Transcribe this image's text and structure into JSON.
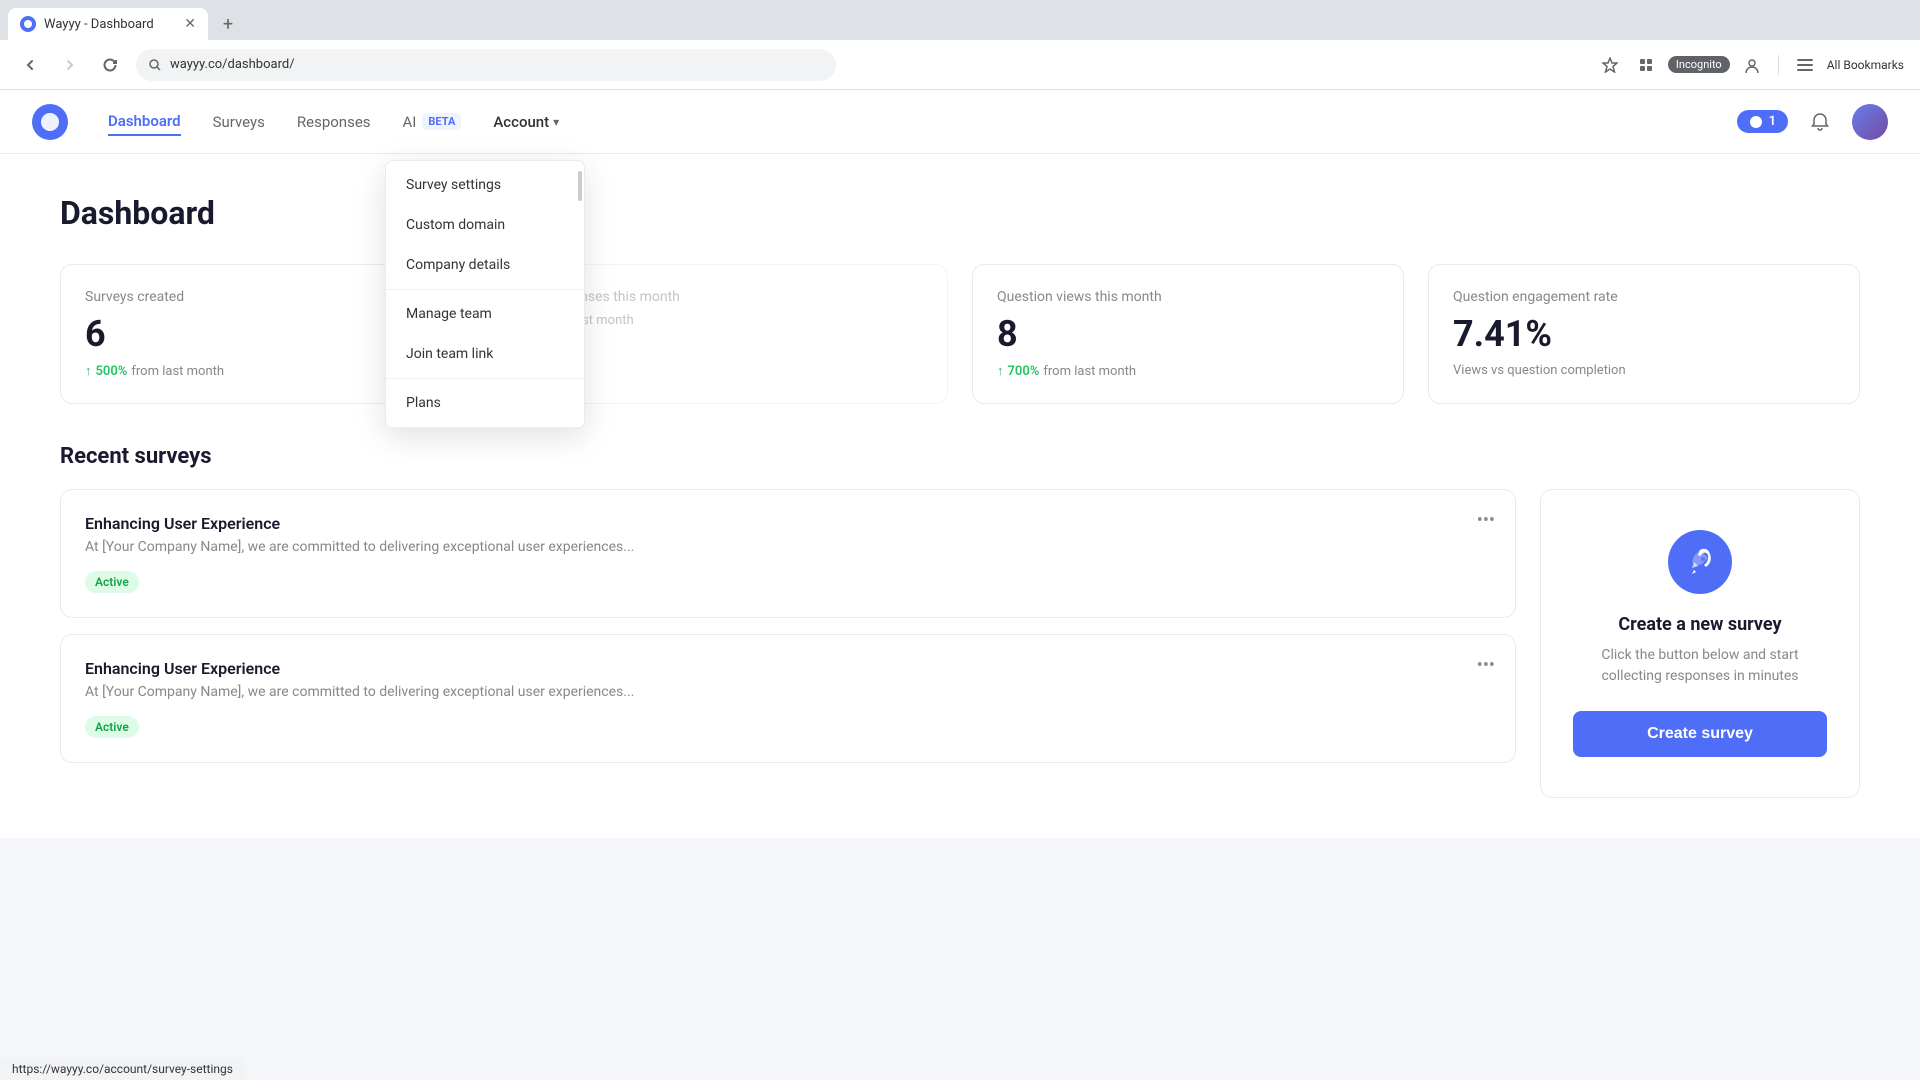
{
  "browser": {
    "tab_title": "Wayyy - Dashboard",
    "address": "wayyy.co/dashboard/",
    "incognito_label": "Incognito",
    "bookmarks_label": "All Bookmarks",
    "new_tab_icon": "+",
    "back_icon": "←",
    "forward_icon": "→",
    "refresh_icon": "↻",
    "star_icon": "☆"
  },
  "nav": {
    "logo_alt": "Wayyy Logo",
    "links": [
      {
        "label": "Dashboard",
        "active": true
      },
      {
        "label": "Surveys",
        "active": false
      },
      {
        "label": "Responses",
        "active": false
      }
    ],
    "ai_label": "AI",
    "ai_badge": "BETA",
    "account_label": "Account",
    "points_label": "1",
    "bell_icon": "🔔"
  },
  "dropdown": {
    "sections": [
      {
        "items": [
          {
            "label": "Survey settings"
          },
          {
            "label": "Custom domain"
          },
          {
            "label": "Company details"
          }
        ]
      },
      {
        "items": [
          {
            "label": "Manage team"
          },
          {
            "label": "Join team link"
          }
        ]
      },
      {
        "items": [
          {
            "label": "Plans"
          }
        ]
      }
    ]
  },
  "page": {
    "title": "Dashboard"
  },
  "stats": [
    {
      "label": "Surveys created",
      "value": "6",
      "trend": "500%",
      "trend_label": "from last month"
    },
    {
      "label": "Responses this month",
      "value": "",
      "trend": "",
      "trend_label": "from last month"
    },
    {
      "label": "Question views this month",
      "value": "8",
      "trend": "700%",
      "trend_label": "from last month"
    },
    {
      "label": "Question engagement rate",
      "value": "7.41%",
      "trend": "",
      "trend_label": "Views vs question completion"
    }
  ],
  "recent_surveys": {
    "title": "Recent surveys",
    "surveys": [
      {
        "title": "Enhancing User Experience",
        "desc": "At [Your Company Name], we are committed to delivering exceptional user experiences...",
        "status": "Active"
      },
      {
        "title": "Enhancing User Experience",
        "desc": "At [Your Company Name], we are committed to delivering exceptional user experiences...",
        "status": "Active"
      }
    ]
  },
  "create_survey_card": {
    "title": "Create a new survey",
    "desc": "Click the button below and start collecting responses in minutes",
    "button_label": "Create survey",
    "icon_alt": "rocket-icon"
  },
  "status_bar": {
    "url": "https://wayyy.co/account/survey-settings"
  }
}
